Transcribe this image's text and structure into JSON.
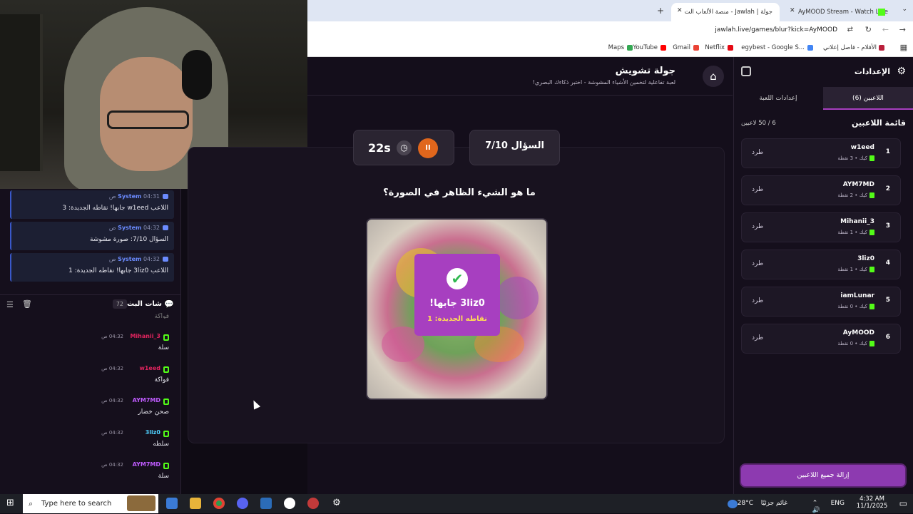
{
  "webcam": {
    "label": ""
  },
  "browser": {
    "tabs": [
      {
        "title": "AyMOOD Stream - Watch Live"
      },
      {
        "title": "جولة | Jawlah - منصة الألعاب الت"
      }
    ],
    "url": "jawlah.live/games/blur?kick=AyMOOD",
    "bookmarks": [
      {
        "label": "الأفلام - فاصل إعلاني",
        "color": "#b91f3b"
      },
      {
        "label": "egybest - Google S...",
        "color": "#4285f4"
      },
      {
        "label": "Netflix",
        "color": "#e50914"
      },
      {
        "label": "Gmail",
        "color": "#ea4335"
      },
      {
        "label": "YouTube",
        "color": "#ff0000"
      },
      {
        "label": "Maps",
        "color": "#34a853"
      }
    ]
  },
  "game": {
    "title": "جولة تشويش",
    "subtitle": "لعبة تفاعلية لتخمين الأشياء المشوشة - اختبر ذكاءك البصري!",
    "question_counter": "السؤال 7/10",
    "timer": "22s",
    "question": "ما هو الشيء الظاهر في الصورة؟",
    "result_title": "3liz0 جابها!",
    "result_sub": "نقاطه الجديدة: 1"
  },
  "chat": {
    "system_messages": [
      {
        "sender": "System",
        "time": "04:31 ص",
        "text": "اللاعب w1eed جابها! نقاطه الجديدة: 3"
      },
      {
        "sender": "System",
        "time": "04:32 ص",
        "text": "السؤال 7/10: صورة مشوشة"
      },
      {
        "sender": "System",
        "time": "04:32 ص",
        "text": "اللاعب 3liz0 جابها! نقاطه الجديدة: 1"
      }
    ],
    "title": "شات البث",
    "count": "72",
    "partial_text": "فواكة",
    "messages": [
      {
        "user": "Mihanii_3",
        "time": "04:32 ص",
        "text": "سلة",
        "color": "#e0245e"
      },
      {
        "user": "w1eed",
        "time": "04:32 ص",
        "text": "فواكة",
        "color": "#e0245e"
      },
      {
        "user": "AYM7MD",
        "time": "04:32 ص",
        "text": "صحن خضار",
        "color": "#c05cff"
      },
      {
        "user": "3liz0",
        "time": "04:32 ص",
        "text": "سلطه",
        "color": "#4fd1ff"
      },
      {
        "user": "AYM7MD",
        "time": "04:32 ص",
        "text": "سلة",
        "color": "#c05cff"
      }
    ]
  },
  "panel": {
    "title": "الإعدادات",
    "tab_players": "اللاعبين (6)",
    "tab_settings": "إعدادات اللعبة",
    "players_heading": "قائمة اللاعبين",
    "players_count": "6 / 50 لاعبين",
    "kick_label": "طرد",
    "players": [
      {
        "rank": "1",
        "name": "w1eed",
        "points": "كيك • 3 نقطة"
      },
      {
        "rank": "2",
        "name": "AYM7MD",
        "points": "كيك • 2 نقطة"
      },
      {
        "rank": "3",
        "name": "Mihanii_3",
        "points": "كيك • 1 نقطة"
      },
      {
        "rank": "4",
        "name": "3liz0",
        "points": "كيك • 1 نقطة"
      },
      {
        "rank": "5",
        "name": "iamLunar",
        "points": "كيك • 0 نقطة"
      },
      {
        "rank": "6",
        "name": "AyMOOD",
        "points": "كيك • 0 نقطة"
      }
    ],
    "remove_all": "إزالة جميع اللاعبين"
  },
  "taskbar": {
    "search_placeholder": "Type here to search",
    "weather": "28°C",
    "weather_text": "غائم جزئيًا",
    "lang": "ENG",
    "time": "4:32 AM",
    "date": "11/1/2025"
  }
}
